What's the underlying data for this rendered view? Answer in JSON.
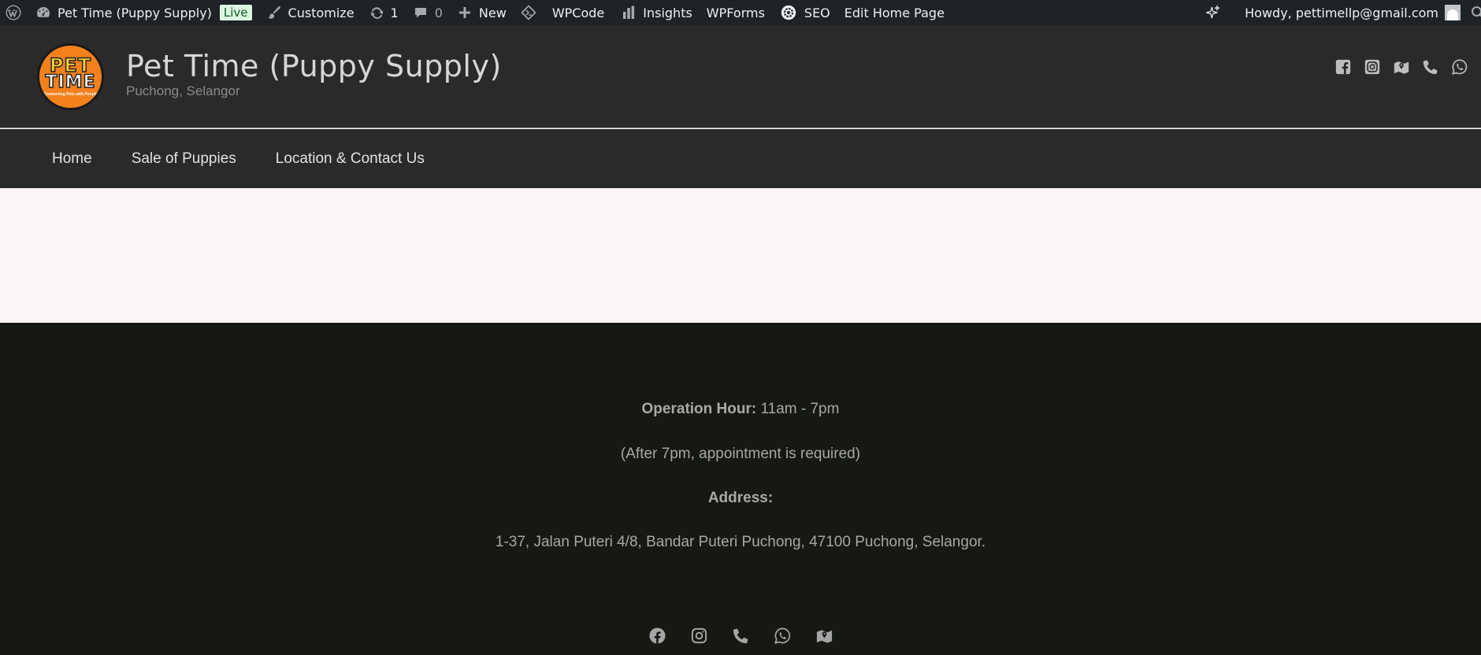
{
  "adminbar": {
    "site_name": "Pet Time (Puppy Supply)",
    "live_badge": "Live",
    "customize": "Customize",
    "updates_count": "1",
    "comments_count": "0",
    "new": "New",
    "wpcode": "WPCode",
    "insights": "Insights",
    "wpforms": "WPForms",
    "seo": "SEO",
    "edit_page": "Edit Home Page",
    "howdy": "Howdy, pettimellp@gmail.com"
  },
  "header": {
    "logo_text_top": "PET",
    "logo_text_bottom": "TIME",
    "logo_tagline": "Connecting Pets with People",
    "title": "Pet Time (Puppy Supply)",
    "description": "Puchong, Selangor",
    "social_icons": [
      "facebook-icon",
      "instagram-icon",
      "map-icon",
      "phone-icon",
      "whatsapp-icon"
    ]
  },
  "nav": {
    "items": [
      {
        "label": "Home"
      },
      {
        "label": "Sale of Puppies"
      },
      {
        "label": "Location & Contact Us"
      }
    ]
  },
  "footer": {
    "operation_label": "Operation Hour:",
    "operation_value": " 11am - 7pm",
    "appointment_note": "(After 7pm, appointment is required)",
    "address_label": "Address:",
    "address_value": "1-37, Jalan Puteri 4/8, Bandar Puteri Puchong, 47100 Puchong, Selangor.",
    "social_icons": [
      "facebook-icon",
      "instagram-icon",
      "phone-icon",
      "whatsapp-icon",
      "map-icon"
    ]
  },
  "colors": {
    "adminbar_bg": "#1d2327",
    "header_bg": "#2a2a2b",
    "content_bg": "#fcf5f5",
    "footer_bg": "#151912",
    "logo_orange": "#f2811d"
  }
}
